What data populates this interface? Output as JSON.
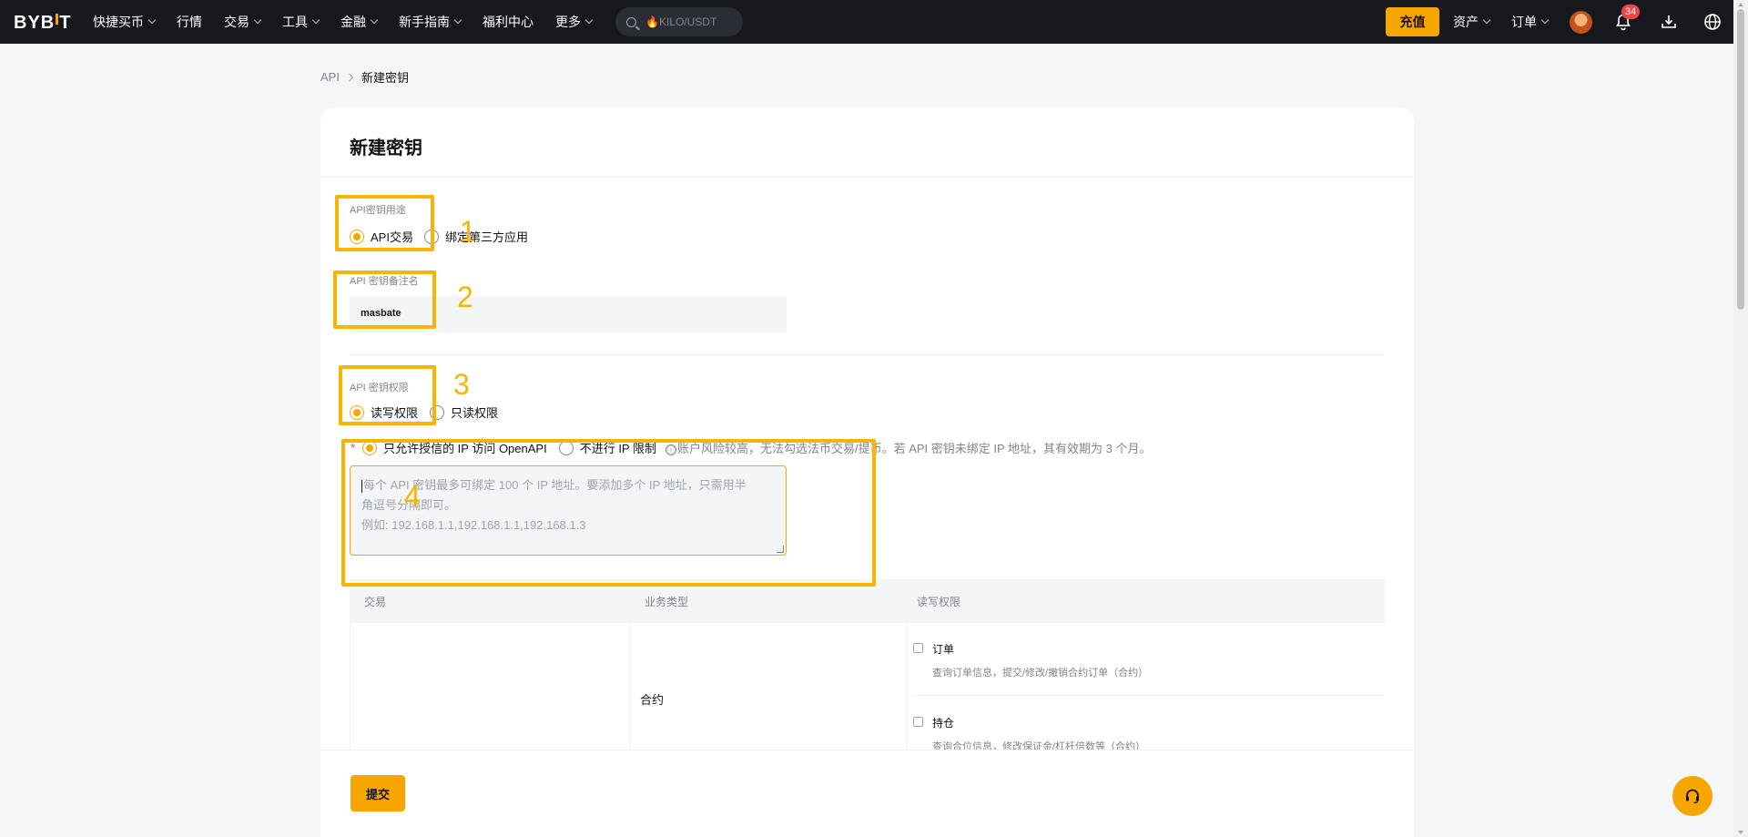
{
  "nav": {
    "logo": "BYBIT",
    "items": [
      "快捷买币",
      "行情",
      "交易",
      "工具",
      "金融",
      "新手指南",
      "福利中心",
      "更多"
    ],
    "items_with_chevron": [
      true,
      false,
      true,
      true,
      true,
      true,
      false,
      true
    ],
    "search_placeholder": "KILO/USDT",
    "search_hot": "🔥",
    "deposit_label": "充值",
    "assets_label": "资产",
    "orders_label": "订单",
    "notification_count": "34",
    "icons": [
      "search-icon",
      "bell-icon",
      "download-icon",
      "globe-icon",
      "headset-icon"
    ]
  },
  "breadcrumb": {
    "parent": "API",
    "current": "新建密钥"
  },
  "page": {
    "title": "新建密钥"
  },
  "form": {
    "usage_label": "API密钥用途",
    "usage_options": [
      "API交易",
      "绑定第三方应用"
    ],
    "usage_selected": "API交易",
    "name_label": "API 密钥备注名",
    "name_value": "masbate",
    "permission_label": "API 密钥权限",
    "permission_options": [
      "读写权限",
      "只读权限"
    ],
    "permission_selected": "读写权限",
    "ip_required_mark": "*",
    "ip_options": [
      "只允许授信的 IP 访问 OpenAPI",
      "不进行 IP 限制"
    ],
    "ip_selected": "只允许授信的 IP 访问 OpenAPI",
    "ip_note_icon": "ⓘ",
    "ip_note": "账户风险较高，无法勾选法币交易/提币。若 API 密钥未绑定 IP 地址，其有效期为 3 个月。",
    "ip_placeholder_line1": "每个 API 密钥最多可绑定 100 个 IP 地址。要添加多个 IP 地址，只需用半",
    "ip_placeholder_line2": "角逗号分隔即可。",
    "ip_placeholder_line3": "例如: 192.168.1.1,192.168.1.1,192.168.1.3"
  },
  "permissions_table": {
    "headers": [
      "交易",
      "业务类型",
      "读写权限"
    ],
    "category": "合约",
    "items": [
      {
        "title": "订单",
        "desc": "查询订单信息，提交/修改/撤销合约订单（合约）"
      },
      {
        "title": "持仓",
        "desc": "查询合位信息，修改保证金/杠杆倍数等（合约）"
      }
    ]
  },
  "submit_label": "提交",
  "annotations": [
    "1",
    "2",
    "3",
    "4"
  ],
  "colors": {
    "accent": "#f7a600",
    "annotation": "#f7b500",
    "nav_bg": "#17181e",
    "badge": "#ef454a"
  }
}
